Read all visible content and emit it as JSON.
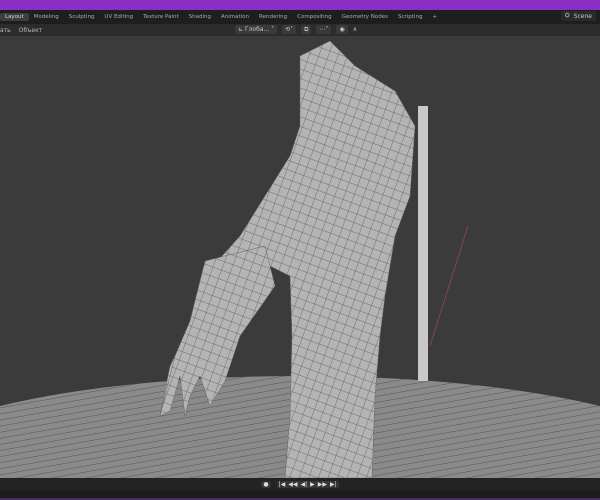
{
  "tabs": [
    "Layout",
    "Modeling",
    "Sculpting",
    "UV Editing",
    "Texture Paint",
    "Shading",
    "Animation",
    "Rendering",
    "Compositing",
    "Geometry Nodes",
    "Scripting",
    "+"
  ],
  "scene_label": "Scene",
  "header": {
    "left": [
      "ать",
      "Объект"
    ],
    "transform_orientation": "Глоба..."
  },
  "playback": {
    "record": "●",
    "buttons": [
      "|◀",
      "◀◀",
      "◀|",
      "▶",
      "▶▶",
      "▶|"
    ]
  },
  "colors": {
    "accent": "#8b2fc4"
  }
}
